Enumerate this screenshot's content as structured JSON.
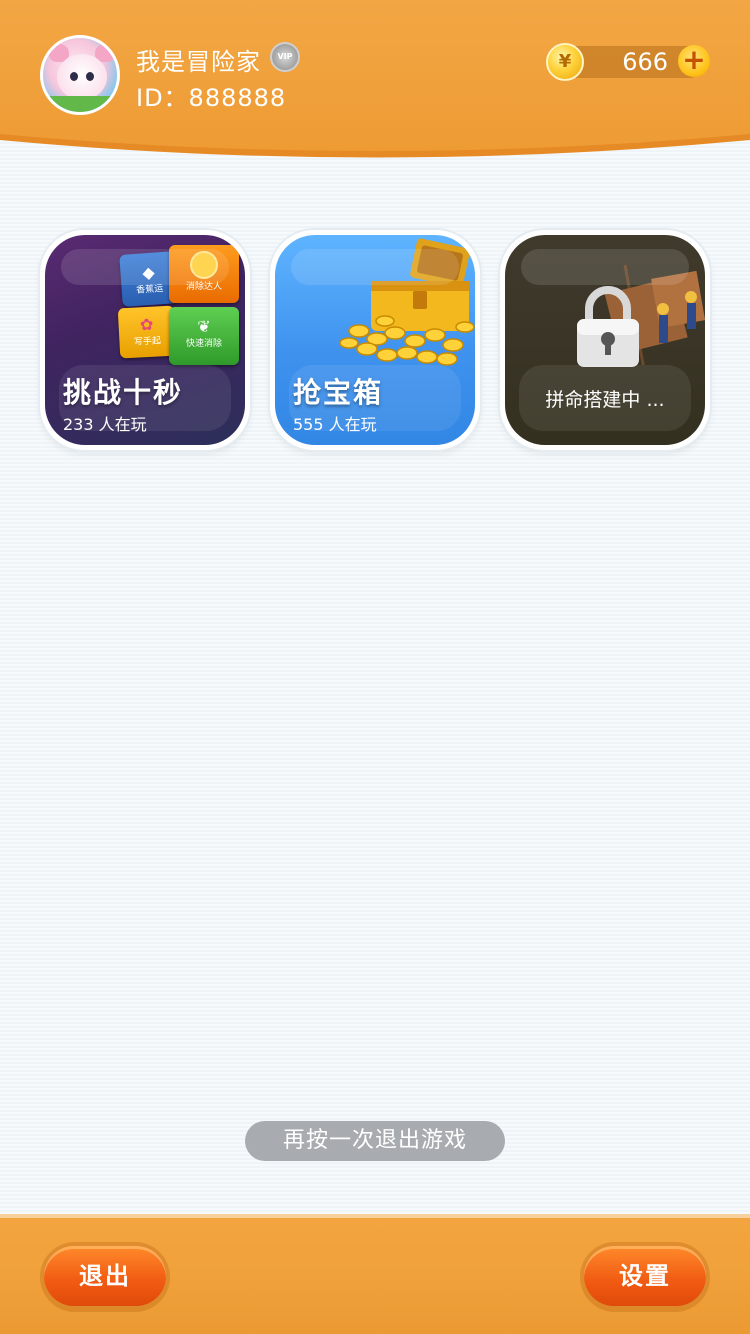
{
  "header": {
    "username": "我是冒险家",
    "vip_badge": "VIP",
    "user_id": "ID：888888",
    "coin_symbol": "¥",
    "coins": "666",
    "add_symbol": "+"
  },
  "games": [
    {
      "title": "挑战十秒",
      "players": "233 人在玩",
      "locked": false,
      "tiles": [
        "香蕉运",
        "消除达人",
        "写手起",
        "快速消除"
      ]
    },
    {
      "title": "抢宝箱",
      "players": "555 人在玩",
      "locked": false
    },
    {
      "title": "",
      "status": "拼命搭建中 ...",
      "locked": true
    }
  ],
  "toast": "再按一次退出游戏",
  "footer": {
    "exit_label": "退出",
    "settings_label": "设置"
  },
  "colors": {
    "header_orange": "#f0a13b",
    "card1": "#402460",
    "card2": "#3f93ef",
    "card3": "#34301f",
    "button_orange": "#f05a12"
  }
}
